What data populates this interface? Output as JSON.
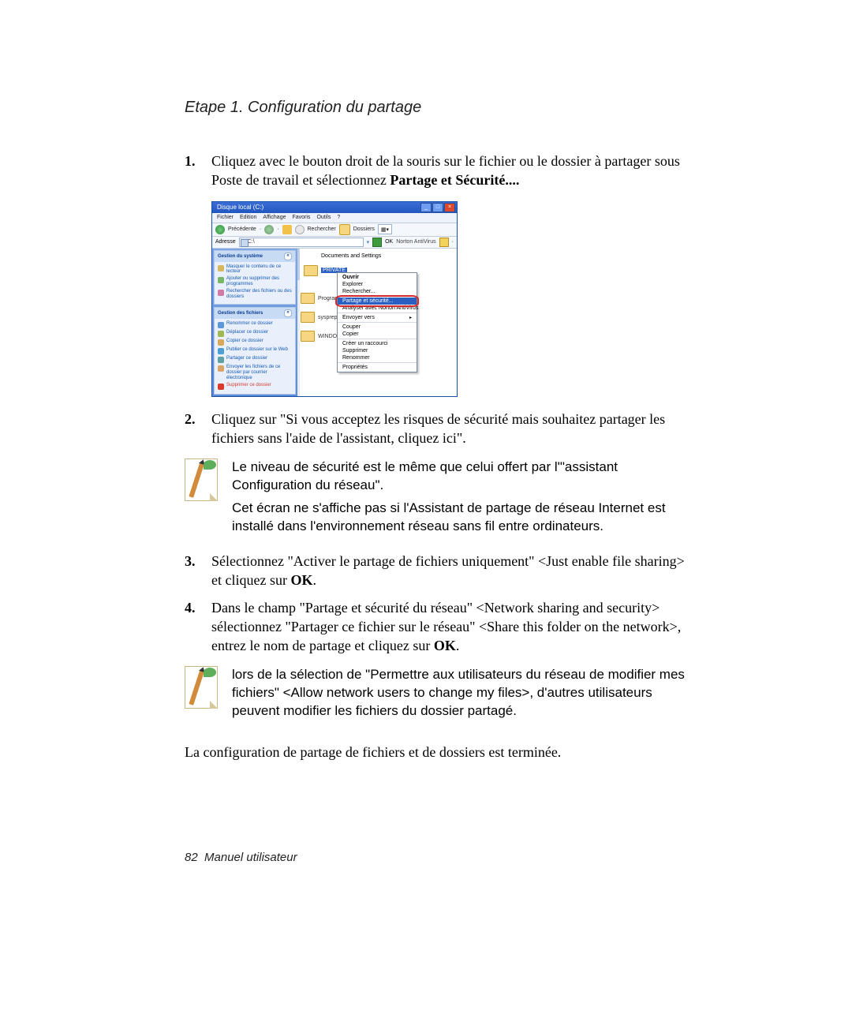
{
  "heading": "Etape 1. Configuration du partage",
  "steps": {
    "1": {
      "marker": "1.",
      "pre": "Cliquez avec le bouton droit de la souris sur le fichier ou le dossier à partager sous Poste de travail et sélectionnez ",
      "bold": "Partage et Sécurité....",
      "post": ""
    },
    "2": {
      "marker": "2.",
      "text": "Cliquez sur \"Si vous acceptez les risques de sécurité mais souhaitez partager les fichiers sans l'aide de l'assistant, cliquez ici\"."
    },
    "3": {
      "marker": "3.",
      "pre": "Sélectionnez \"Activer le partage de fichiers uniquement\" <Just enable file sharing> et cliquez sur ",
      "bold": "OK",
      "post": "."
    },
    "4": {
      "marker": "4.",
      "pre": "Dans le champ \"Partage et sécurité du réseau\" <Network sharing and security> sélectionnez \"Partager ce fichier sur le réseau\" <Share this folder on the network>, entrez le nom de partage et cliquez sur ",
      "bold": "OK",
      "post": "."
    }
  },
  "note1": {
    "p1": "Le niveau de sécurité est le même que celui offert par l'\"assistant Configuration du réseau\".",
    "p2": "Cet écran ne s'affiche pas si l'Assistant de partage de réseau Internet est installé dans l'environnement réseau sans fil entre ordinateurs."
  },
  "note2": {
    "p1": "lors de la sélection de \"Permettre aux utilisateurs du réseau de modifier mes fichiers\" <Allow network users to change my files>, d'autres utilisateurs peuvent modifier les fichiers du dossier partagé."
  },
  "conclusion": "La configuration de partage de fichiers et de dossiers est terminée.",
  "footer": {
    "page": "82",
    "label": "Manuel utilisateur"
  },
  "screenshot": {
    "title": "Disque local (C:)",
    "menus": {
      "m1": "Fichier",
      "m2": "Edition",
      "m3": "Affichage",
      "m4": "Favoris",
      "m5": "Outils",
      "m6": "?"
    },
    "toolbar": {
      "back": "Précédente",
      "search": "Rechercher",
      "folders": "Dossiers"
    },
    "address": {
      "label": "Adresse",
      "value": "C:\\",
      "go": "OK",
      "nav": "Norton AntiVirus"
    },
    "panels": {
      "sys": {
        "title": "Gestion du système",
        "i1": "Masquer le contenu de ce lecteur",
        "i2": "Ajouter ou supprimer des programmes",
        "i3": "Rechercher des fichiers ou des dossiers"
      },
      "files": {
        "title": "Gestion des fichiers",
        "i1": "Renommer ce dossier",
        "i2": "Déplacer ce dossier",
        "i3": "Copier ce dossier",
        "i4": "Publier ce dossier sur le Web",
        "i5": "Partager ce dossier",
        "i6": "Envoyer les fichiers de ce dossier par courrier électronique",
        "i7": "Supprimer ce dossier"
      }
    },
    "main": {
      "header": "Documents and Settings",
      "selected": "PRIVATE",
      "behind": {
        "b1": "Program",
        "b2": "sysprep",
        "b3": "WINDO"
      }
    },
    "ctx": {
      "open": "Ouvrir",
      "explorer": "Explorer",
      "search": "Rechercher...",
      "share": "Partage et sécurité...",
      "scan": "Analyser avec Norton AntiVirus",
      "sendto": "Envoyer vers",
      "cut": "Couper",
      "copy": "Copier",
      "shortcut": "Créer un raccourci",
      "delete": "Supprimer",
      "rename": "Renommer",
      "props": "Propriétés"
    }
  }
}
